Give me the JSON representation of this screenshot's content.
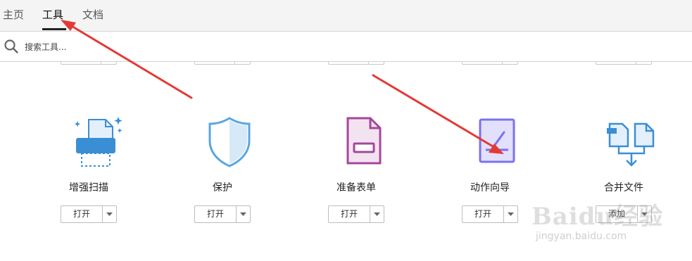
{
  "tabs": [
    {
      "label": "主页",
      "active": false
    },
    {
      "label": "工具",
      "active": true
    },
    {
      "label": "文档",
      "active": false
    }
  ],
  "search": {
    "placeholder": "搜索工具..."
  },
  "tools": [
    {
      "name": "增强扫描",
      "icon": "scan-printer-icon",
      "button": "打开"
    },
    {
      "name": "保护",
      "icon": "shield-icon",
      "button": "打开"
    },
    {
      "name": "准备表单",
      "icon": "form-document-icon",
      "button": "打开"
    },
    {
      "name": "动作向导",
      "icon": "action-wizard-icon",
      "button": "打开"
    },
    {
      "name": "合并文件",
      "icon": "combine-files-icon",
      "button": "添加"
    }
  ],
  "watermark": {
    "logo": "Baidu经验",
    "sub": "jingyan.baidu.com"
  },
  "colors": {
    "tab_bar": "#f4f4f4",
    "annotation_arrow": "#e53935",
    "scan_icon": "#3a8fd4",
    "protect_icon": "#5aa6e0",
    "form_icon": "#a6479a",
    "wizard_icon": "#7b72ec",
    "combine_icon": "#3a8fd4"
  }
}
